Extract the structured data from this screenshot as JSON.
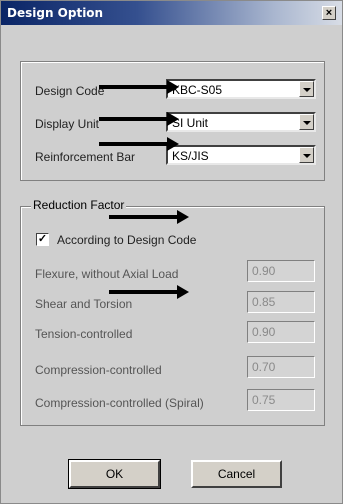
{
  "dialog": {
    "title": "Design Option",
    "close_glyph": "×"
  },
  "settings": {
    "rows": [
      {
        "label": "Design Code",
        "value": "KBC-S05"
      },
      {
        "label": "Display Unit",
        "value": "SI Unit"
      },
      {
        "label": "Reinforcement Bar",
        "value": "KS/JIS"
      }
    ]
  },
  "reduction": {
    "legend": "Reduction Factor",
    "checkbox_label": "According to Design Code",
    "checkbox_checked": true,
    "check_glyph": "✓",
    "factors": [
      {
        "label": "Flexure, without Axial Load",
        "value": "0.90"
      },
      {
        "label": "Shear and Torsion",
        "value": "0.85"
      },
      {
        "label": "Tension-controlled",
        "value": "0.90"
      },
      {
        "label": "Compression-controlled",
        "value": "0.70"
      },
      {
        "label": "Compression-controlled (Spiral)",
        "value": "0.75"
      }
    ]
  },
  "buttons": {
    "ok": "OK",
    "cancel": "Cancel"
  },
  "annotations": {
    "arrow_color": "#000000"
  }
}
